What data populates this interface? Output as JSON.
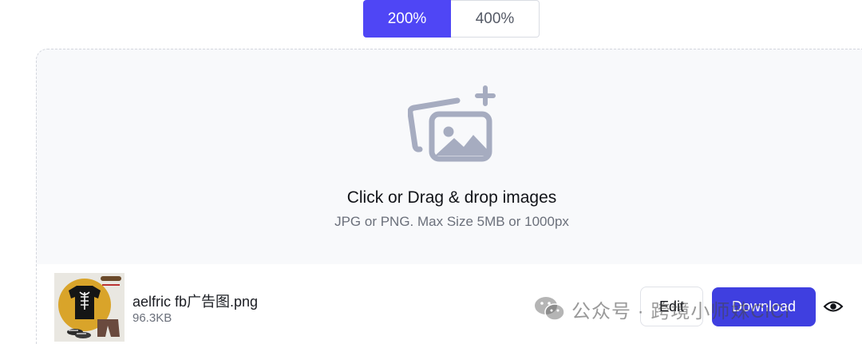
{
  "scale_toggle": {
    "options": [
      {
        "label": "200%",
        "selected": true
      },
      {
        "label": "400%",
        "selected": false
      }
    ]
  },
  "dropzone": {
    "icon": "add-image-icon",
    "title": "Click or Drag & drop images",
    "subtitle": "JPG or PNG. Max Size 5MB or 1000px"
  },
  "file": {
    "thumbnail": "product-thumbnail",
    "name": "aelfric fb广告图.png",
    "size": "96.3KB",
    "edit_label": "Edit",
    "download_label": "Download",
    "preview_icon": "eye-icon"
  },
  "watermark": {
    "icon": "wechat-icon",
    "text": "公众号 · 跨境小师妹CiCi"
  },
  "colors": {
    "accent": "#4f46f5",
    "download": "#3f3fe0",
    "icon_gray": "#a6acc0"
  }
}
